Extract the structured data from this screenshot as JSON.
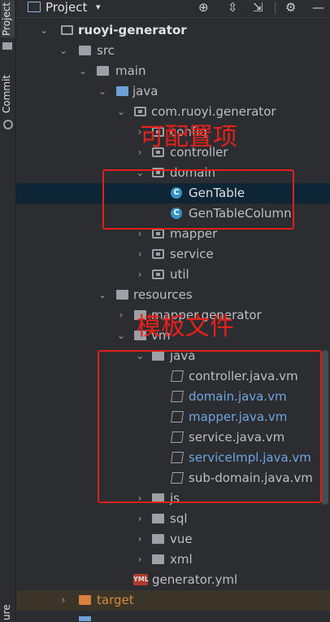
{
  "toolwindow": {
    "title": "Project",
    "caret": "▾"
  },
  "strip": {
    "project": "Project",
    "commit": "Commit",
    "structure": "ure"
  },
  "tree": {
    "ruoyi_generator": "ruoyi-generator",
    "src": "src",
    "main": "main",
    "java": "java",
    "package": "com.ruoyi.generator",
    "config": "config",
    "controller": "controller",
    "domain": "domain",
    "gentable": "GenTable",
    "gentablecolumn": "GenTableColumn",
    "mapper": "mapper",
    "service": "service",
    "util": "util",
    "resources": "resources",
    "mapper_generator": "mapper.generator",
    "vm": "vm",
    "vm_java": "java",
    "controller_vm": "controller.java.vm",
    "domain_vm": "domain.java.vm",
    "mapper_vm": "mapper.java.vm",
    "service_vm": "service.java.vm",
    "serviceimpl_vm": "serviceImpl.java.vm",
    "subdomain_vm": "sub-domain.java.vm",
    "js": "js",
    "sql": "sql",
    "vue": "vue",
    "xml": "xml",
    "generator_yml": "generator.yml",
    "target": "target"
  },
  "annotations": {
    "configurable": "可配置项",
    "template_files": "模板文件"
  },
  "colors": {
    "annotation": "#e0201a",
    "selected_row": "#0d2535",
    "modified_file": "#6ea5e0",
    "excluded_folder": "#d9803c"
  }
}
